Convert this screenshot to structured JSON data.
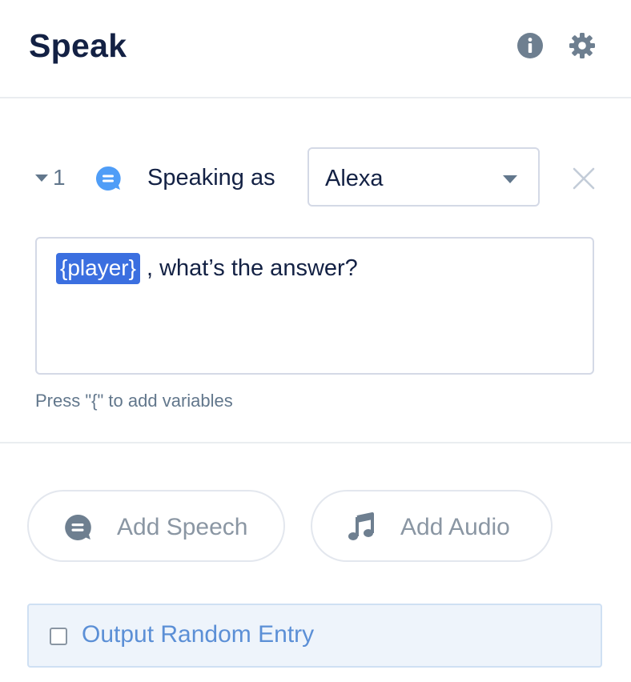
{
  "header": {
    "title": "Speak"
  },
  "item": {
    "index": "1",
    "speaking_as_label": "Speaking as",
    "voice": "Alexa"
  },
  "speech": {
    "variable": "{player}",
    "text": ", what’s the answer?",
    "hint": "Press \"{\" to add variables"
  },
  "actions": {
    "add_speech": "Add Speech",
    "add_audio": "Add Audio"
  },
  "random": {
    "label": "Output Random Entry",
    "checked": false
  },
  "icons": {
    "info": "info-icon",
    "settings": "gear-icon",
    "speech": "speech-bubble-icon",
    "remove": "close-icon",
    "audio": "music-note-icon"
  },
  "colors": {
    "title": "#132144",
    "muted": "#62778c",
    "variable_chip": "#3b6fe0",
    "speech_icon": "#4f9df7",
    "random_bg": "#eef4fb",
    "random_text": "#5b8fd6"
  }
}
